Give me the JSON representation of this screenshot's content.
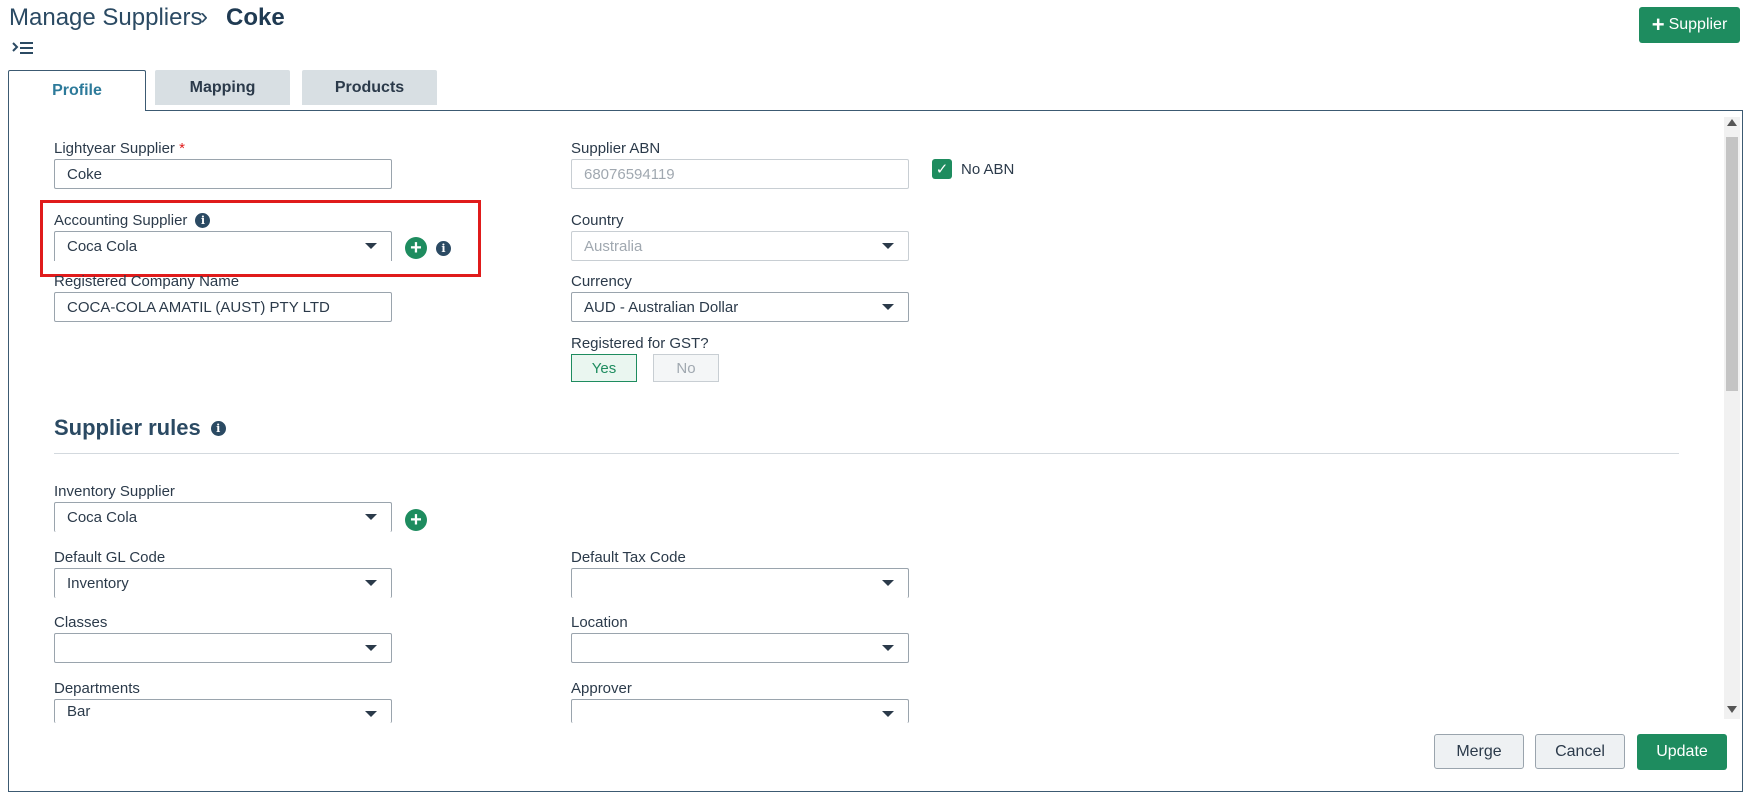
{
  "breadcrumb": {
    "parent": "Manage Suppliers",
    "separator": "›",
    "current": "Coke"
  },
  "header": {
    "add_supplier_label": "Supplier"
  },
  "tabs": [
    {
      "label": "Profile",
      "active": true
    },
    {
      "label": "Mapping",
      "active": false
    },
    {
      "label": "Products",
      "active": false
    }
  ],
  "profile": {
    "lightyear_supplier": {
      "label": "Lightyear Supplier",
      "required_mark": "*",
      "value": "Coke"
    },
    "supplier_abn": {
      "label": "Supplier ABN",
      "value": "68076594119"
    },
    "no_abn": {
      "label": "No ABN",
      "checked": true
    },
    "accounting_supplier": {
      "label": "Accounting Supplier",
      "value": "Coca Cola"
    },
    "country": {
      "label": "Country",
      "value": "Australia"
    },
    "registered_company_name": {
      "label": "Registered Company Name",
      "value": "COCA-COLA AMATIL (AUST) PTY LTD"
    },
    "currency": {
      "label": "Currency",
      "value": "AUD - Australian Dollar"
    },
    "registered_gst": {
      "label": "Registered for GST?",
      "yes": "Yes",
      "no": "No",
      "selected": "Yes"
    }
  },
  "supplier_rules": {
    "title": "Supplier rules",
    "inventory_supplier": {
      "label": "Inventory Supplier",
      "value": "Coca Cola"
    },
    "default_gl_code": {
      "label": "Default GL Code",
      "value": "Inventory"
    },
    "default_tax_code": {
      "label": "Default Tax Code",
      "value": ""
    },
    "classes": {
      "label": "Classes",
      "value": ""
    },
    "location": {
      "label": "Location",
      "value": ""
    },
    "departments": {
      "label": "Departments",
      "value": "Bar"
    },
    "approver": {
      "label": "Approver",
      "value": ""
    }
  },
  "footer": {
    "merge_label": "Merge",
    "cancel_label": "Cancel",
    "update_label": "Update"
  },
  "icons": {
    "info": "i",
    "plus": "+",
    "check": "✓",
    "menu": "menu-collapse-icon"
  },
  "colors": {
    "accent_green": "#1e8c5f",
    "highlight_red": "#e01b1b",
    "heading": "#2b4a63"
  }
}
